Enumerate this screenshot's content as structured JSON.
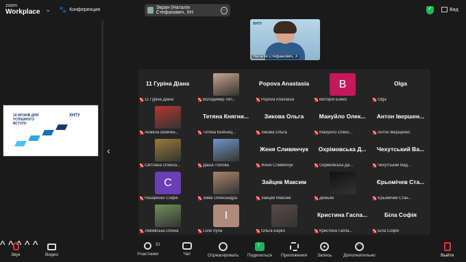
{
  "topbar": {
    "logo_line1": "zoom",
    "logo_line2": "Workplace",
    "meeting_label": "Конференция",
    "share_label": "Экран (Наталія Стефанович, ХН",
    "view_label": "Вид"
  },
  "slide": {
    "title": "10 КРОКІВ ДЛЯ УСПІШНОГО ВСТУПУ",
    "brand": "ХНТУ"
  },
  "speaker": {
    "logo": "ХНТУ",
    "caption": "Наталія Стефанович, Х"
  },
  "tiles": [
    {
      "display": "11 Гуріна Діана",
      "caption": "11 Гуріна Діана",
      "type": "name"
    },
    {
      "display": "",
      "caption": "Володимир Лит...",
      "type": "photo",
      "color": "#c9a38a"
    },
    {
      "display": "Popova Anastasia",
      "caption": "Popova Anastasia",
      "type": "name"
    },
    {
      "display": "B",
      "caption": "Вікторія Бойко",
      "type": "letter",
      "color": "#c4185b"
    },
    {
      "display": "Olga",
      "caption": "Olga",
      "type": "name"
    },
    {
      "display": "",
      "caption": "Анжела Шевчен...",
      "type": "photo",
      "color": "#b5372e"
    },
    {
      "display": "Тетяна Княгни...",
      "caption": "Тетяна Княгниц...",
      "type": "name"
    },
    {
      "display": "Зикова Ольга",
      "caption": "Зикова Ольга",
      "type": "name"
    },
    {
      "display": "Мануйло Олек...",
      "caption": "Мануйло Олекс...",
      "type": "name"
    },
    {
      "display": "Антон Івершен...",
      "caption": "Антон Іверщенко",
      "type": "name"
    },
    {
      "display": "",
      "caption": "Світлана Олекса...",
      "type": "photo",
      "color": "#9a7a3a"
    },
    {
      "display": "",
      "caption": "Даша Попова",
      "type": "photo",
      "color": "#6f96c9"
    },
    {
      "display": "Женя Сливянчук",
      "caption": "Женя Сливянчук",
      "type": "name"
    },
    {
      "display": "Охрімовська Д...",
      "caption": "Охрімовська Да...",
      "type": "name"
    },
    {
      "display": "Чехутський Ва...",
      "caption": "Чехутський Вад...",
      "type": "name"
    },
    {
      "display": "C",
      "caption": "Назаренко Софія",
      "type": "letter",
      "color": "#6a3fb5"
    },
    {
      "display": "",
      "caption": "Зима Олександра",
      "type": "photo",
      "color": "#a8846a"
    },
    {
      "display": "Зайцев Максим",
      "caption": "Зайцев Максим",
      "type": "name"
    },
    {
      "display": "",
      "caption": "Демьян",
      "type": "photo",
      "color": "#111111"
    },
    {
      "display": "Єрьомічев Ста...",
      "caption": "Єрьомічев Стан...",
      "type": "name"
    },
    {
      "display": "",
      "caption": "Левківська Олена",
      "type": "photo",
      "color": "#6f8f5a"
    },
    {
      "display": "I",
      "caption": "Lurie Iryna",
      "type": "letter",
      "color": "#b08a7a"
    },
    {
      "display": "",
      "caption": "Ольга Берко",
      "type": "photo",
      "color": "#5a4a44"
    },
    {
      "display": "Кристина Гаспа...",
      "caption": "Кристина Гаспа...",
      "type": "name"
    },
    {
      "display": "Біла Софія",
      "caption": "Біла Софія",
      "type": "name"
    }
  ],
  "toolbar": {
    "audio": "Звук",
    "video": "Видео",
    "participants": "Участники",
    "participants_count": "31",
    "chat": "Чат",
    "react": "Отреагировать",
    "share": "Поделиться",
    "apps": "Приложения",
    "record": "Запись",
    "more": "Дополнительно",
    "leave": "Выйти"
  },
  "colors": {
    "background": "#1a1a1a",
    "gallery": "#242424",
    "share_green": "#1fb35f",
    "mute_red": "#e02828"
  }
}
